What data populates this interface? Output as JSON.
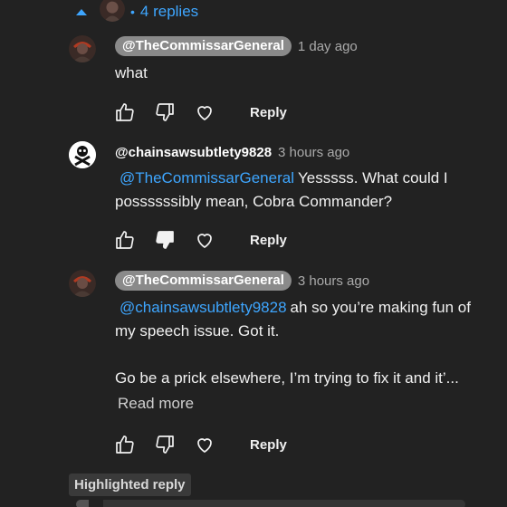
{
  "replies_toggle": {
    "label": "4 replies",
    "separator": "•"
  },
  "comments": [
    {
      "author": "@TheCommissarGeneral",
      "time": "1 day ago",
      "mention": "",
      "text": "what",
      "read_more": "",
      "disliked": false
    },
    {
      "author": "@chainsawsubtlety9828",
      "time": "3 hours ago",
      "mention": "@TheCommissarGeneral",
      "text": "Yesssss.  What could I possssssibly mean, Cobra Commander?",
      "read_more": "",
      "disliked": true
    },
    {
      "author": "@TheCommissarGeneral",
      "time": "3 hours ago",
      "mention": "@chainsawsubtlety9828",
      "text": "ah so you’re making fun of my speech issue. Got it.",
      "text_2": "Go be a prick elsewhere, I’m trying to fix it and it’...",
      "read_more": "Read more",
      "disliked": false
    }
  ],
  "reply_label": "Reply",
  "highlighted_badge": "Highlighted reply",
  "icons": {
    "like": "thumbs-up-icon",
    "dislike": "thumbs-down-icon",
    "heart": "heart-icon",
    "expand": "caret-up-icon"
  },
  "colors": {
    "link": "#3ea6ff",
    "background": "#222222",
    "author_pill": "#8a8a8a"
  }
}
